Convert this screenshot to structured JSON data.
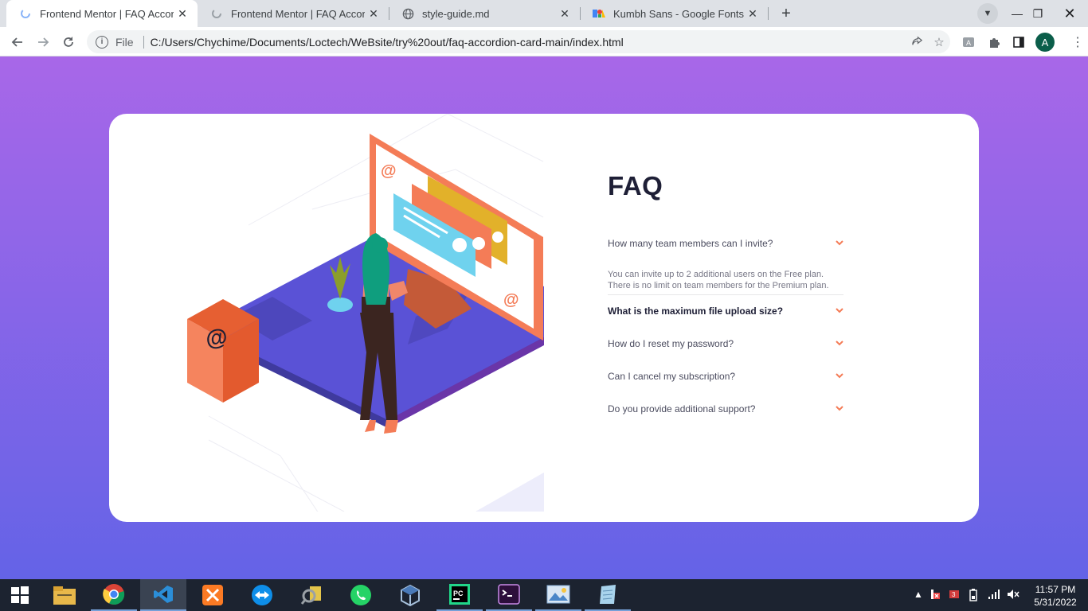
{
  "browser": {
    "tabs": [
      {
        "title": "Frontend Mentor | FAQ Accordion",
        "active": true
      },
      {
        "title": "Frontend Mentor | FAQ Accordion",
        "active": false
      },
      {
        "title": "style-guide.md",
        "active": false
      },
      {
        "title": "Kumbh Sans - Google Fonts",
        "active": false
      }
    ],
    "omnibox": {
      "scheme": "File",
      "url": "C:/Users/Chychime/Documents/Loctech/WeBsite/try%20out/faq-accordion-card-main/index.html"
    },
    "profile_initial": "A"
  },
  "page": {
    "heading": "FAQ",
    "faqs": [
      {
        "question": "How many team members can I invite?",
        "answer": "You can invite up to 2 additional users on the Free plan. There is no limit on team members for the Premium plan.",
        "open": true
      },
      {
        "question": "What is the maximum file upload size?",
        "open": false,
        "bold": true
      },
      {
        "question": "How do I reset my password?",
        "open": false
      },
      {
        "question": "Can I cancel my subscription?",
        "open": false
      },
      {
        "question": "Do you provide additional support?",
        "open": false
      }
    ],
    "colors": {
      "gradient_top": "#a867e8",
      "gradient_bottom": "#6463e7",
      "accent": "#f47c57",
      "heading": "#1e1f36"
    }
  },
  "taskbar": {
    "apps": [
      "start",
      "file-explorer",
      "chrome",
      "vscode",
      "xampp",
      "teamviewer",
      "search-tool",
      "whatsapp",
      "virtualbox",
      "pycharm",
      "terminal",
      "photos",
      "notepad"
    ],
    "clock": {
      "time": "11:57 PM",
      "date": "5/31/2022"
    }
  }
}
